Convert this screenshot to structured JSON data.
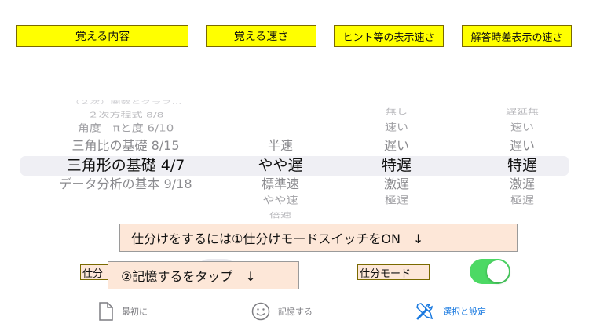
{
  "headers": [
    "覚える内容",
    "覚える速さ",
    "ヒント等の表示速さ",
    "解答時差表示の速さ"
  ],
  "wheels": {
    "content": [
      "（２次）関数とグラフ…",
      "２次方程式 8/8",
      "角度　πと度 6/10",
      "三角比の基礎 8/15",
      "三角形の基礎 4/7",
      "データ分析の基本 9/18"
    ],
    "speed": [
      "半速",
      "やや遅",
      "標準速",
      "やや速",
      "倍速"
    ],
    "hint": [
      "無し",
      "速い",
      "遅い",
      "特遅",
      "激遅",
      "極遅"
    ],
    "delay": [
      "遅延無",
      "速い",
      "遅い",
      "特遅",
      "激遅",
      "極遅"
    ]
  },
  "instructions": {
    "line1": "仕分けをするには①仕分けモードスイッチをON　↓",
    "line2": "②記憶するをタップ　↓"
  },
  "mode_label_left": "仕分",
  "mode_label_right": "仕分モード",
  "mode_switch_on": true,
  "tabs": {
    "first": "最初に",
    "memorize": "記憶する",
    "settings": "選択と設定"
  },
  "colors": {
    "header_bg": "#ffff00",
    "instruction_bg": "#fde7d8",
    "switch_on": "#4cd964",
    "tab_active": "#1a7ae0"
  }
}
